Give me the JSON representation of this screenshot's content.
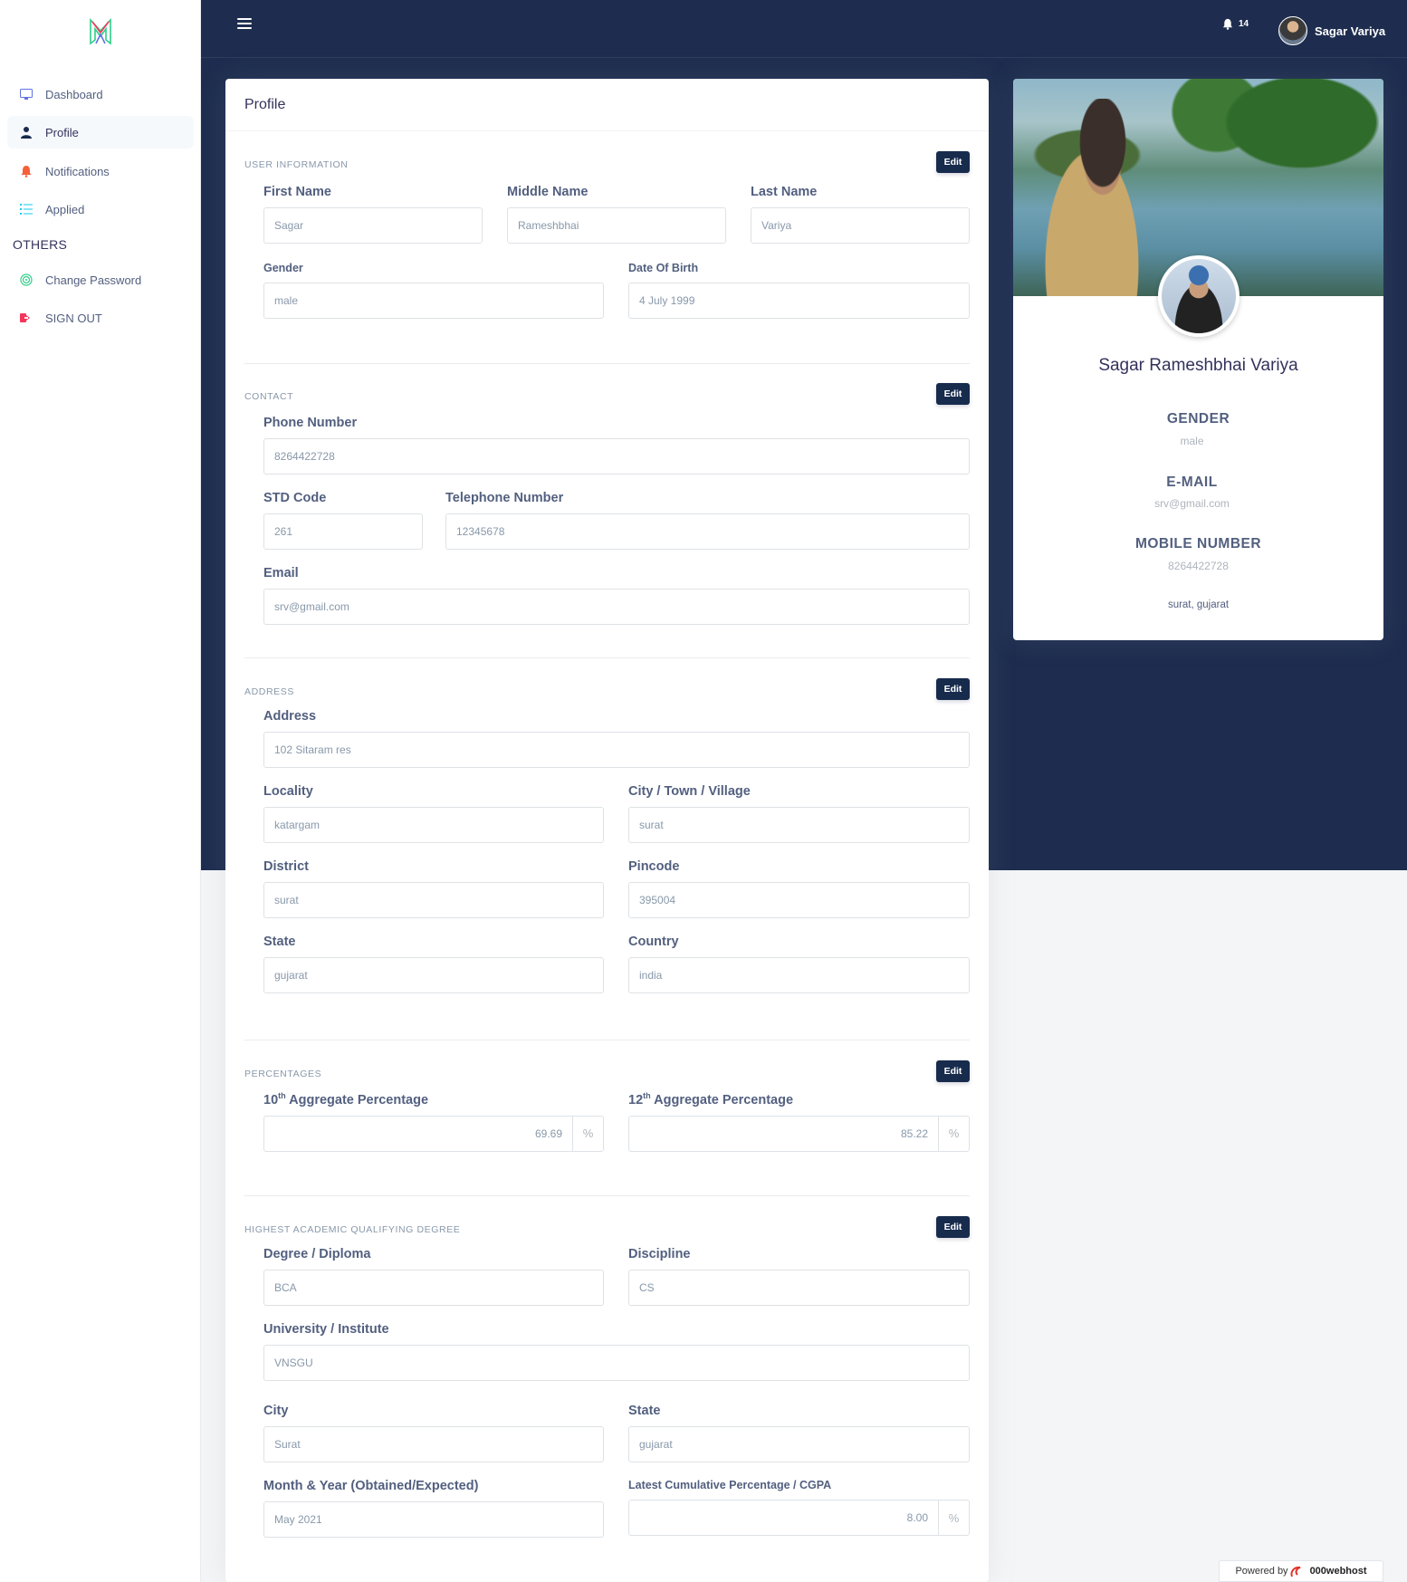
{
  "sidebar": {
    "items": [
      {
        "label": "Dashboard",
        "icon": "monitor-icon"
      },
      {
        "label": "Profile",
        "icon": "user-icon"
      },
      {
        "label": "Notifications",
        "icon": "bell-icon"
      },
      {
        "label": "Applied",
        "icon": "list-icon"
      }
    ],
    "others_heading": "OTHERS",
    "others": [
      {
        "label": "Change Password",
        "icon": "fingerprint-icon"
      },
      {
        "label": "SIGN OUT",
        "icon": "sign-out-icon"
      }
    ]
  },
  "topbar": {
    "notification_count": "14",
    "user_name": "Sagar Variya"
  },
  "main": {
    "title": "Profile",
    "edit_label": "Edit",
    "user_info": {
      "title": "USER INFORMATION",
      "first_name_label": "First Name",
      "first_name": "Sagar",
      "middle_name_label": "Middle Name",
      "middle_name": "Rameshbhai",
      "last_name_label": "Last Name",
      "last_name": "Variya",
      "gender_label": "Gender",
      "gender": "male",
      "dob_label": "Date Of Birth",
      "dob": "4 July 1999"
    },
    "contact": {
      "title": "CONTACT",
      "phone_label": "Phone Number",
      "phone": "8264422728",
      "std_label": "STD Code",
      "std": "261",
      "tel_label": "Telephone Number",
      "tel": "12345678",
      "email_label": "Email",
      "email": "srv@gmail.com"
    },
    "address": {
      "title": "ADDRESS",
      "address_label": "Address",
      "address": "102 Sitaram res",
      "locality_label": "Locality",
      "locality": "katargam",
      "city_label": "City / Town / Village",
      "city": "surat",
      "district_label": "District",
      "district": "surat",
      "pincode_label": "Pincode",
      "pincode": "395004",
      "state_label": "State",
      "state": "gujarat",
      "country_label": "Country",
      "country": "india"
    },
    "percentages": {
      "title": "PERCENTAGES",
      "tenth_num": "10",
      "tenth_sup": "th",
      "tenth_rest": " Aggregate Percentage",
      "tenth": "69.69",
      "twelfth_num": "12",
      "twelfth_sup": "th",
      "twelfth_rest": " Aggregate Percentage",
      "twelfth": "85.22",
      "unit": "%"
    },
    "degree": {
      "title": "HIGHEST ACADEMIC QUALIFYING DEGREE",
      "degree_label": "Degree / Diploma",
      "degree": "BCA",
      "discipline_label": "Discipline",
      "discipline": "CS",
      "university_label": "University / Institute",
      "university": "VNSGU",
      "city_label": "City",
      "city": "Surat",
      "state_label": "State",
      "state": "gujarat",
      "month_label": "Month & Year (Obtained/Expected)",
      "month": "May 2021",
      "cgpa_label": "Latest Cumulative Percentage / CGPA",
      "cgpa": "8.00",
      "unit": "%"
    }
  },
  "profile_card": {
    "name": "Sagar Rameshbhai Variya",
    "gender_title": "GENDER",
    "gender": "male",
    "email_title": "E-MAIL",
    "email": "srv@gmail.com",
    "mobile_title": "MOBILE NUMBER",
    "mobile": "8264422728",
    "location": "surat, gujarat"
  },
  "footer": {
    "powered_by": "Powered by",
    "brand": "000webhost"
  },
  "colors": {
    "header_navy": "#1e2d4f",
    "button_navy": "#172b4d",
    "notification_orange": "#f5603a",
    "applied_teal": "#11cdef",
    "password_green": "#2dce89",
    "signout_red": "#f5365c"
  }
}
